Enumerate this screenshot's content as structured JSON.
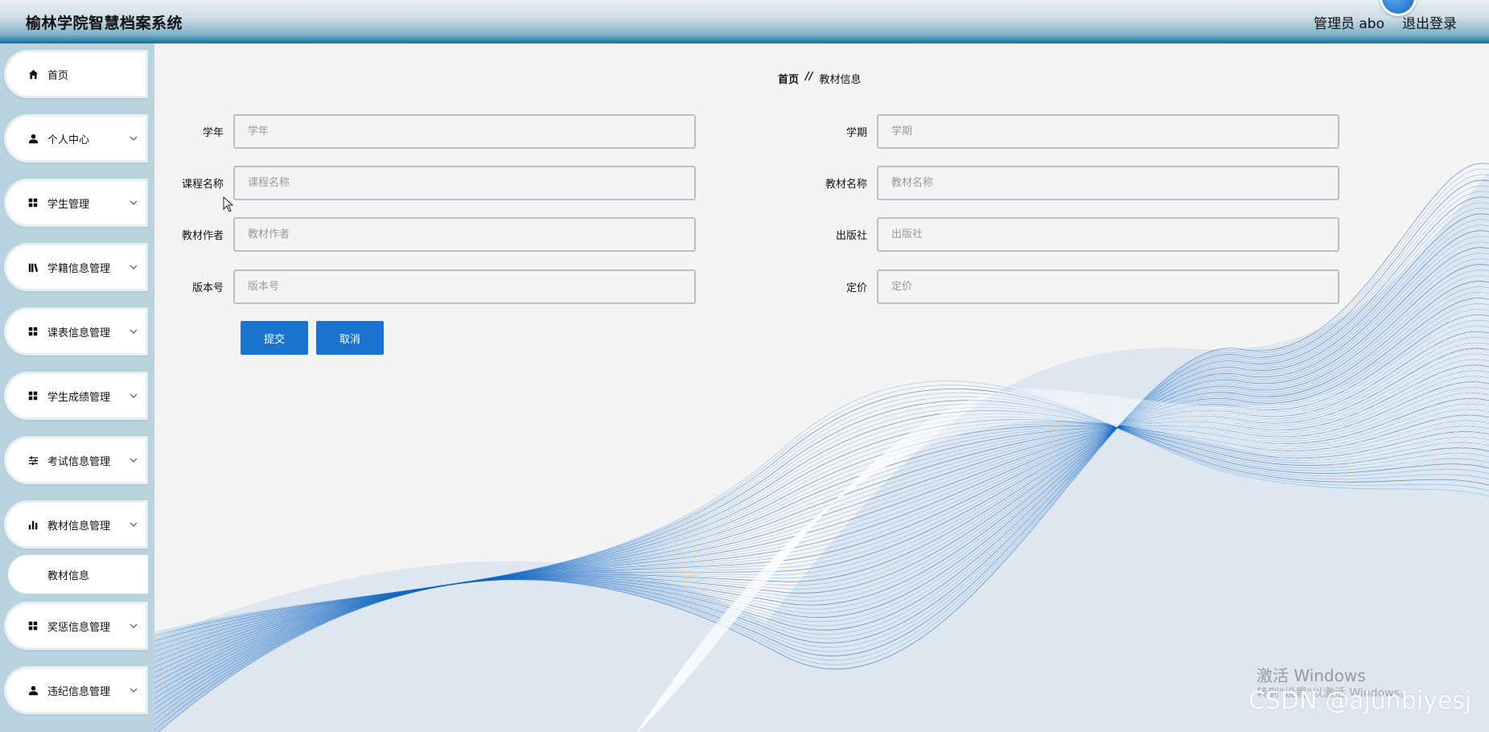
{
  "header": {
    "app_title": "榆林学院智慧档案系统",
    "user_label": "管理员 abo",
    "logout_label": "退出登录"
  },
  "sidebar": {
    "items": [
      {
        "label": "首页",
        "icon": "home-icon",
        "has_submenu": false
      },
      {
        "label": "个人中心",
        "icon": "user-icon",
        "has_submenu": true
      },
      {
        "label": "学生管理",
        "icon": "grid-icon",
        "has_submenu": true
      },
      {
        "label": "学籍信息管理",
        "icon": "library-icon",
        "has_submenu": true
      },
      {
        "label": "课表信息管理",
        "icon": "grid-icon",
        "has_submenu": true
      },
      {
        "label": "学生成绩管理",
        "icon": "grid-icon",
        "has_submenu": true
      },
      {
        "label": "考试信息管理",
        "icon": "sliders-icon",
        "has_submenu": true
      },
      {
        "label": "教材信息管理",
        "icon": "bar-chart-icon",
        "has_submenu": true,
        "expanded": true,
        "children": [
          {
            "label": "教材信息"
          }
        ]
      },
      {
        "label": "奖惩信息管理",
        "icon": "grid-icon",
        "has_submenu": true
      },
      {
        "label": "违纪信息管理",
        "icon": "user-icon",
        "has_submenu": true
      }
    ]
  },
  "breadcrumb": {
    "home": "首页",
    "separator": "//",
    "current": "教材信息"
  },
  "form": {
    "fields": [
      {
        "label": "学年",
        "placeholder": "学年",
        "value": ""
      },
      {
        "label": "学期",
        "placeholder": "学期",
        "value": ""
      },
      {
        "label": "课程名称",
        "placeholder": "课程名称",
        "value": ""
      },
      {
        "label": "教材名称",
        "placeholder": "教材名称",
        "value": ""
      },
      {
        "label": "教材作者",
        "placeholder": "教材作者",
        "value": ""
      },
      {
        "label": "出版社",
        "placeholder": "出版社",
        "value": ""
      },
      {
        "label": "版本号",
        "placeholder": "版本号",
        "value": ""
      },
      {
        "label": "定价",
        "placeholder": "定价",
        "value": ""
      }
    ],
    "submit_label": "提交",
    "cancel_label": "取消"
  },
  "watermarks": {
    "windows": "激活 Windows",
    "windows_sub": "转到\"设置\"以激活 Windows。",
    "csdn": "CSDN @ajunbiyesj"
  },
  "colors": {
    "primary": "#1a73cf",
    "sidebar_bg": "#b9d3df",
    "header_dark": "#0f6f9e",
    "wave": "#1976d2"
  }
}
